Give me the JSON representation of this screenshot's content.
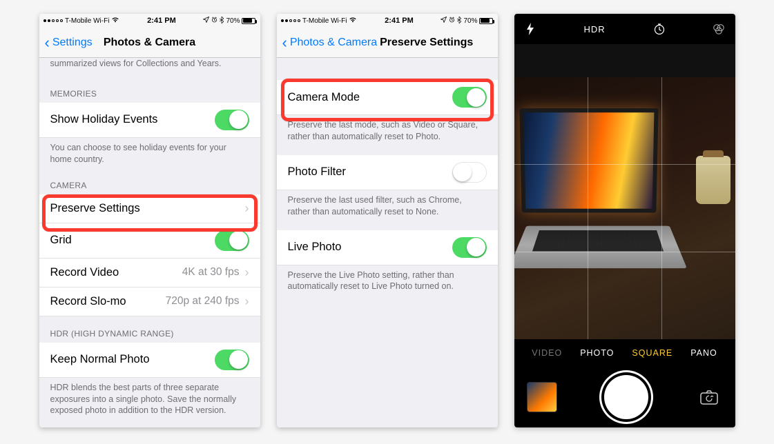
{
  "status": {
    "carrier": "T-Mobile Wi-Fi",
    "time": "2:41 PM",
    "battery_pct": "70%"
  },
  "screen1": {
    "back_label": "Settings",
    "title": "Photos & Camera",
    "truncated_footer": "summarized views for Collections and Years.",
    "memories_header": "MEMORIES",
    "show_holiday": "Show Holiday Events",
    "holiday_footer": "You can choose to see holiday events for your home country.",
    "camera_header": "CAMERA",
    "preserve": "Preserve Settings",
    "grid": "Grid",
    "record_video": "Record Video",
    "record_video_value": "4K at 30 fps",
    "record_slomo": "Record Slo-mo",
    "record_slomo_value": "720p at 240 fps",
    "hdr_header": "HDR (HIGH DYNAMIC RANGE)",
    "keep_normal": "Keep Normal Photo",
    "hdr_footer": "HDR blends the best parts of three separate exposures into a single photo. Save the normally exposed photo in addition to the HDR version."
  },
  "screen2": {
    "back_label": "Photos & Camera",
    "title": "Preserve Settings",
    "camera_mode": "Camera Mode",
    "camera_mode_footer": "Preserve the last mode, such as Video or Square, rather than automatically reset to Photo.",
    "photo_filter": "Photo Filter",
    "photo_filter_footer": "Preserve the last used filter, such as Chrome, rather than automatically reset to None.",
    "live_photo": "Live Photo",
    "live_photo_footer": "Preserve the Live Photo setting, rather than automatically reset to Live Photo turned on."
  },
  "screen3": {
    "hdr": "HDR",
    "modes": {
      "video": "VIDEO",
      "photo": "PHOTO",
      "square": "SQUARE",
      "pano": "PANO"
    },
    "active_mode": "SQUARE"
  }
}
